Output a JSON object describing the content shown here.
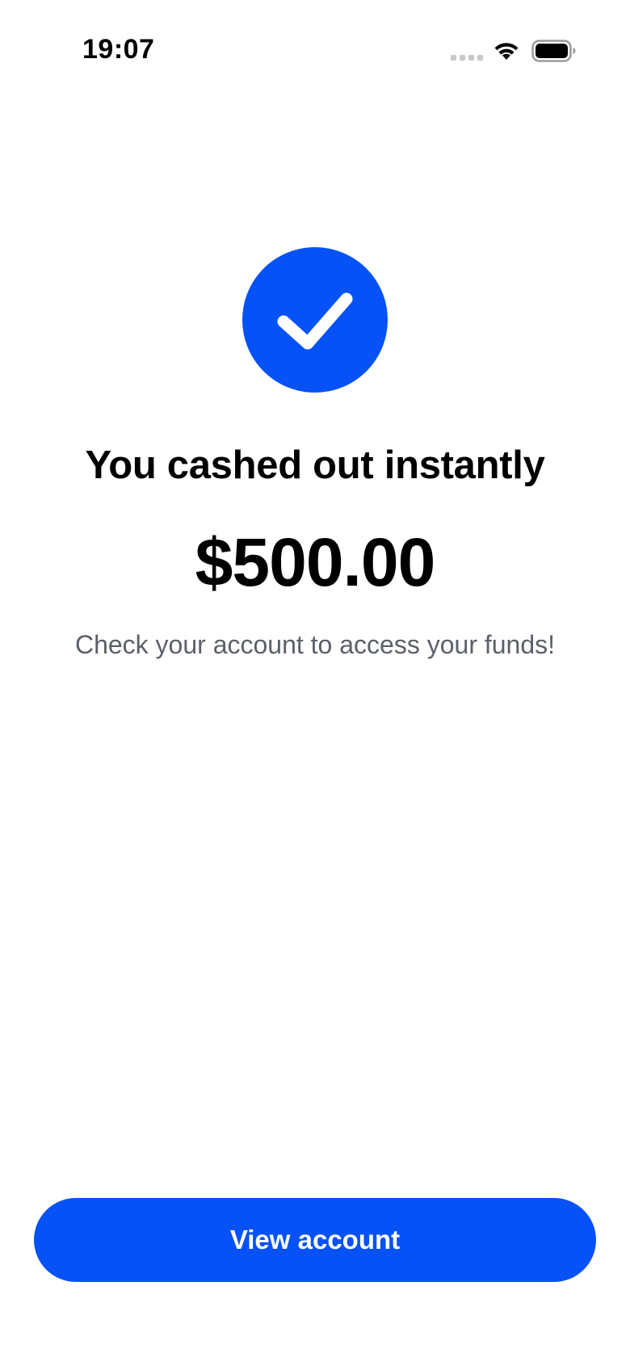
{
  "status_bar": {
    "time": "19:07",
    "signal_icon": "cellular-signal-icon",
    "wifi_icon": "wifi-icon",
    "battery_icon": "battery-icon"
  },
  "confirmation": {
    "icon": "checkmark-icon",
    "accent_color": "#0652f6",
    "headline": "You cashed out instantly",
    "amount": "$500.00",
    "message": "Check your account to access your funds!"
  },
  "actions": {
    "view_account_label": "View account"
  }
}
